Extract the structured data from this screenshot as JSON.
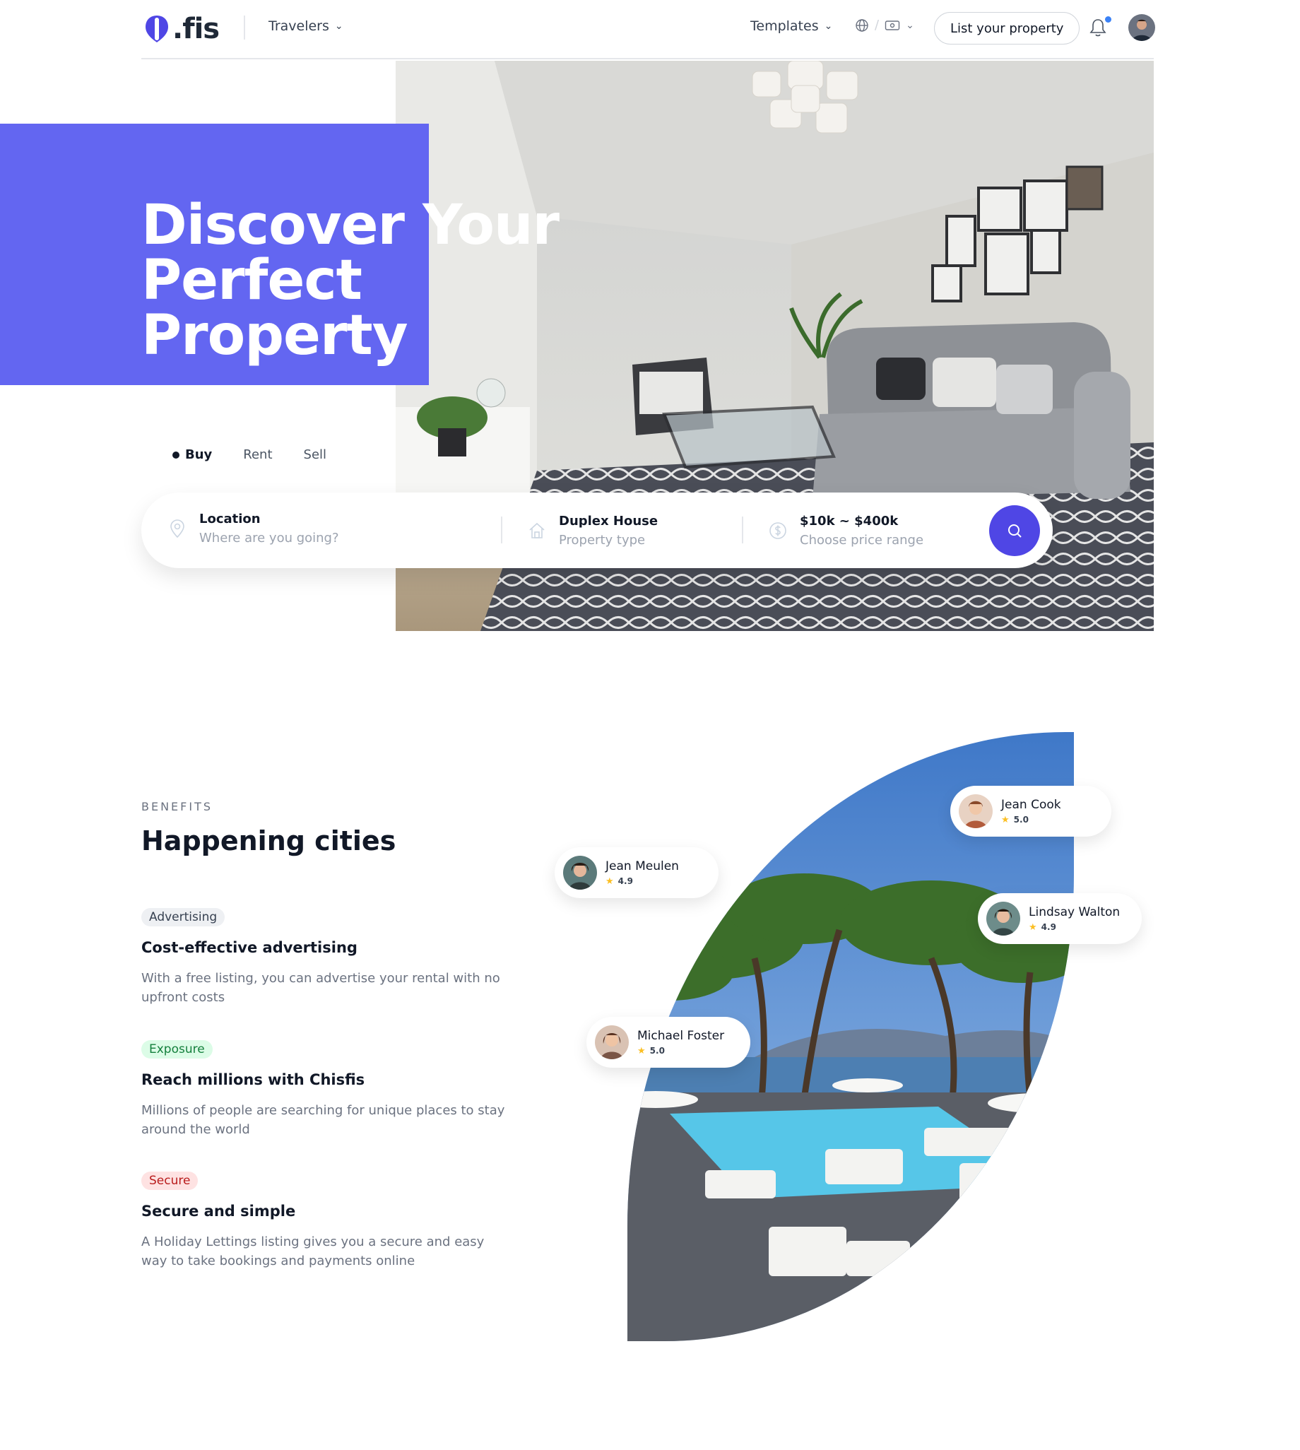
{
  "header": {
    "logo_text": ".fis",
    "travelers_label": "Travelers",
    "templates_label": "Templates",
    "list_property_label": "List your property",
    "accent": "#4f46e5",
    "notification_dot_color": "#3b82f6"
  },
  "hero": {
    "title_line1": "Discover Your",
    "title_line2": "Perfect Property",
    "block_color": "#6366f1",
    "tabs": [
      {
        "label": "Buy",
        "active": true
      },
      {
        "label": "Rent",
        "active": false
      },
      {
        "label": "Sell",
        "active": false
      }
    ],
    "search": {
      "location_label": "Location",
      "location_placeholder": "Where are you going?",
      "property_label": "Duplex House",
      "property_sub": "Property type",
      "price_label": "$10k ~ $400k",
      "price_sub": "Choose price range",
      "icons": [
        "location-pin-icon",
        "house-icon",
        "dollar-icon",
        "search-icon"
      ]
    }
  },
  "benefits": {
    "eyebrow": "BENEFITS",
    "title": "Happening cities",
    "items": [
      {
        "badge": "Advertising",
        "badge_color": "gray",
        "title": "Cost-effective advertising",
        "text": "With a free listing, you can advertise your rental with no upfront costs"
      },
      {
        "badge": "Exposure",
        "badge_color": "green",
        "title": "Reach millions with Chisfis",
        "text": "Millions of people are searching for unique places to stay around the world"
      },
      {
        "badge": "Secure",
        "badge_color": "red",
        "title": "Secure and simple",
        "text": "A Holiday Lettings listing gives you a secure and easy way to take bookings and payments online"
      }
    ]
  },
  "reviewers": [
    {
      "name": "Jean Cook",
      "rating": "5.0"
    },
    {
      "name": "Jean Meulen",
      "rating": "4.9"
    },
    {
      "name": "Lindsay Walton",
      "rating": "4.9"
    },
    {
      "name": "Michael Foster",
      "rating": "5.0"
    }
  ]
}
